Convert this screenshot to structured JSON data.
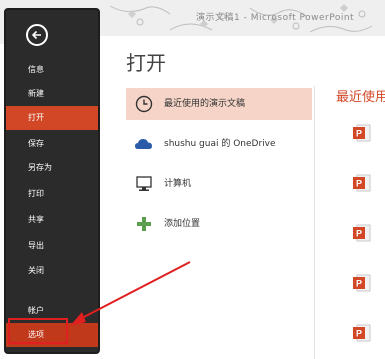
{
  "window": {
    "title": "演示文稿1 - Microsoft PowerPoint"
  },
  "sidebar": {
    "items": [
      {
        "key": "info",
        "label": "信息",
        "state": "normal"
      },
      {
        "key": "new",
        "label": "新建",
        "state": "normal"
      },
      {
        "key": "open",
        "label": "打开",
        "state": "active"
      },
      {
        "key": "save",
        "label": "保存",
        "state": "normal"
      },
      {
        "key": "saveas",
        "label": "另存为",
        "state": "normal"
      },
      {
        "key": "print",
        "label": "打印",
        "state": "normal"
      },
      {
        "key": "share",
        "label": "共享",
        "state": "normal"
      },
      {
        "key": "export",
        "label": "导出",
        "state": "normal"
      },
      {
        "key": "close",
        "label": "关闭",
        "state": "normal"
      }
    ],
    "account_label": "帐户",
    "options_label": "选项",
    "back_icon": "back-arrow-icon"
  },
  "main": {
    "title": "打开",
    "places": [
      {
        "label": "最近使用的演示文稿",
        "icon": "clock-icon",
        "selected": true
      },
      {
        "label": "shushu guai 的 OneDrive",
        "icon": "cloud-icon",
        "selected": false
      },
      {
        "label": "计算机",
        "icon": "computer-icon",
        "selected": false
      },
      {
        "label": "添加位置",
        "icon": "plus-icon",
        "selected": false
      }
    ],
    "recent_title": "最近使用"
  },
  "colors": {
    "accent": "#d24726",
    "selected_bg": "#f6d5c8",
    "sidebar_bg": "#2b2b2b",
    "cloud": "#2a5ba8",
    "plus": "#5a9e4e",
    "annotation": "#e02020"
  }
}
